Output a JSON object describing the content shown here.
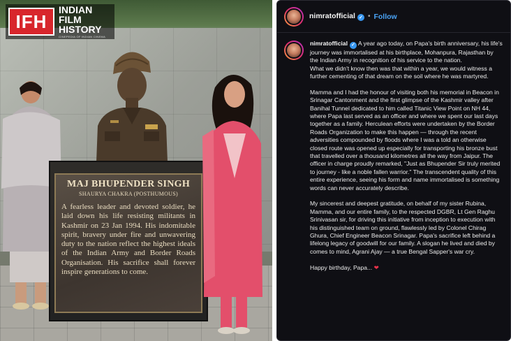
{
  "logo": {
    "mark": "IFH",
    "line1": "INDIAN",
    "line2": "FILM",
    "line3": "HISTORY",
    "tagline": "CINEPEDIA OF INDIAN CINEMA"
  },
  "plaque": {
    "name": "MAJ BHUPENDER SINGH",
    "award": "SHAURYA CHAKRA (POSTHUMOUS)",
    "inscription": "A fearless leader and devoted soldier, he laid down his life resisting militants in Kashmir on 23 Jan 1994. His indomitable spirit, bravery under fire and unwavering duty to the nation reflect the highest ideals of the Indian Army and Border Roads Organisation. His sacrifice shall forever inspire generations to come."
  },
  "post": {
    "header": {
      "username": "nimratofficial",
      "separator": "•",
      "follow_label": "Follow"
    },
    "caption": {
      "username": "nimratofficial",
      "paragraphs": [
        "A year ago today, on Papa's birth anniversary, his life's journey was immortalised at his birthplace, Mohanpura, Rajasthan by the Indian Army in recognition of his service to the nation.\nWhat we didn't know then was that within a year, we would witness a further cementing of that dream on the soil where he was martyred.",
        "Mamma and I had the honour of visiting both his memorial in Beacon in Srinagar Cantonment and the first glimpse of the Kashmir valley after Banihal Tunnel dedicated to him called Titanic View Point on NH 44, where Papa last served as an officer and where we spent our last days together as a family. Herculean efforts were undertaken by the Border Roads Organization to make this happen — through the recent adversities compounded by floods where I was a told an otherwise closed route was opened up especially for transporting his bronze bust that travelled over a thousand kilometres all the way from Jaipur. The officer in charge proudly remarked, \"Just as Bhupender Sir truly merited to journey - like a noble fallen warrior.\" The transcendent quality of this entire experience, seeing his form and name immortalised is something words can never accurately describe.",
        "My sincerest and deepest gratitude, on behalf of my sister Rubina, Mamma, and our entire family, to the respected DGBR, Lt Gen Raghu Srinivasan sir, for driving this initiative from inception to execution with his distinguished team on ground, flawlessly led by Colonel Chirag Ghura, Chief Engineer Beacon Srinagar. Papa's sacrifice left behind a lifelong legacy of goodwill for our family. A slogan he lived and died by comes to mind, Agrani Ajay — a true Bengal Sapper's war cry.",
        "Happy birthday, Papa..."
      ],
      "closing_emoji": "❤"
    }
  },
  "colors": {
    "background": "#0f0f14",
    "follow_blue": "#4aa3f5",
    "verified_blue": "#3897f0",
    "logo_red": "#d8262c",
    "heart_red": "#e8334a"
  }
}
